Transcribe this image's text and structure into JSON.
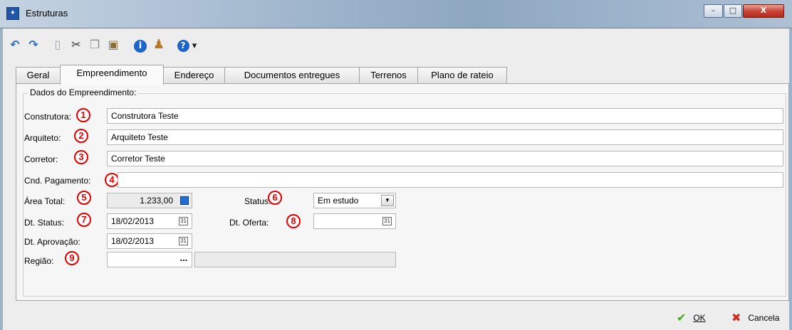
{
  "window": {
    "title": "Estruturas",
    "app_icon": "window-app-icon",
    "controls": {
      "minimize": "–",
      "maximize": "□",
      "close": "X"
    }
  },
  "toolbar": {
    "items": [
      {
        "name": "undo-icon",
        "glyph": "↶",
        "color": "#2b6cbd"
      },
      {
        "name": "redo-icon",
        "glyph": "↷",
        "color": "#2b6cbd"
      },
      {
        "name": "new-doc-icon",
        "glyph": "▯",
        "color": "#9aa4b0"
      },
      {
        "name": "cut-icon",
        "glyph": "✂",
        "color": "#333333"
      },
      {
        "name": "copy-icon",
        "glyph": "❐",
        "color": "#8a8a8a"
      },
      {
        "name": "paste-icon",
        "glyph": "▣",
        "color": "#8a6e3c"
      },
      {
        "name": "info-icon",
        "glyph": "i",
        "color": "#1d63c8"
      },
      {
        "name": "user-icon",
        "glyph": "♟",
        "color": "#b47a2a"
      },
      {
        "name": "help-icon",
        "glyph": "?",
        "color": "#1d63c8"
      },
      {
        "name": "dropdown-arrow-icon",
        "glyph": "▾",
        "color": "#222222"
      }
    ]
  },
  "tabs": [
    {
      "label": "Geral",
      "underline": "e"
    },
    {
      "label": "Empreendimento",
      "active": true
    },
    {
      "label": "Endereço",
      "underline": "E"
    },
    {
      "label": "Documentos entregues"
    },
    {
      "label": "Terrenos",
      "underline": "T"
    },
    {
      "label": "Plano de rateio"
    }
  ],
  "form": {
    "group_title": "Dados do Empreendimento:",
    "construtora": {
      "label": "Construtora:",
      "value": "Construtora Teste",
      "marker": "1"
    },
    "arquiteto": {
      "label": "Arquiteto:",
      "value": "Arquiteto Teste",
      "marker": "2"
    },
    "corretor": {
      "label": "Corretor:",
      "value": "Corretor Teste",
      "marker": "3"
    },
    "cnd_pagamento": {
      "label": "Cnd. Pagamento:",
      "value": "",
      "marker": "4"
    },
    "area_total": {
      "label": "Área Total:",
      "value": "1.233,00",
      "marker": "5"
    },
    "status": {
      "label": "Status:",
      "value": "Em estudo",
      "marker": "6"
    },
    "dt_status": {
      "label": "Dt. Status:",
      "value": "18/02/2013",
      "marker": "7"
    },
    "dt_oferta": {
      "label": "Dt. Oferta:",
      "value": "",
      "marker": "8"
    },
    "dt_aprovacao": {
      "label": "Dt. Aprovação:",
      "value": "18/02/2013"
    },
    "regiao": {
      "label": "Região:",
      "value": "",
      "description": "",
      "button": "...",
      "marker": "9"
    },
    "calendar_glyph": "31"
  },
  "footer": {
    "ok": {
      "label": "OK",
      "underline": "O",
      "icon_color": "#3ea81c"
    },
    "cancel": {
      "label": "Cancela",
      "underline": "C",
      "icon_color": "#d22a1c"
    }
  }
}
